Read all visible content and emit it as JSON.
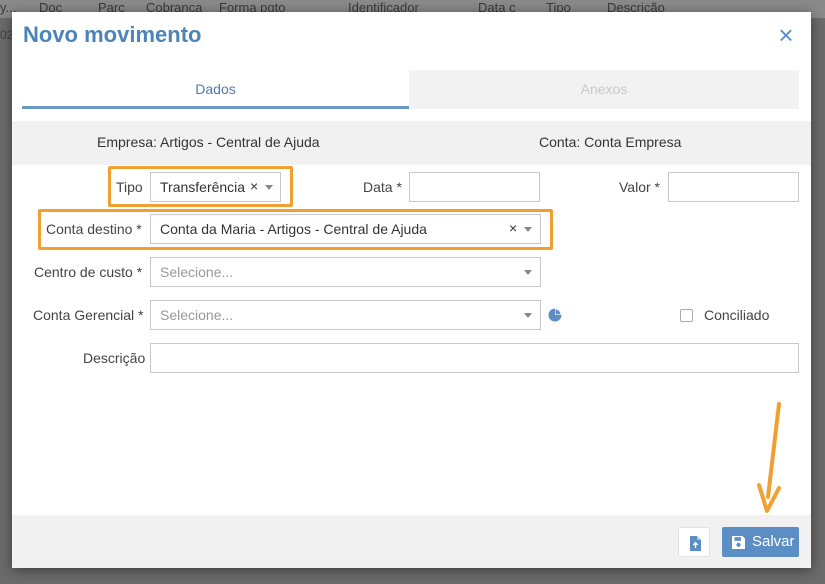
{
  "background": {
    "columns": [
      "y...",
      "Doc",
      "Parc",
      "Cobrança",
      "Forma pgto",
      "Identificador",
      "Data c",
      "Tipo",
      "Descrição"
    ],
    "left_fragment": "02"
  },
  "modal": {
    "title": "Novo movimento",
    "close_glyph": "×",
    "tabs": [
      {
        "label": "Dados",
        "active": true
      },
      {
        "label": "Anexos",
        "active": false
      }
    ],
    "info": {
      "empresa": "Empresa: Artigos - Central de Ajuda",
      "conta": "Conta: Conta Empresa"
    },
    "form": {
      "tipo": {
        "label": "Tipo",
        "value": "Transferência",
        "clear": "×"
      },
      "data": {
        "label": "Data *",
        "value": ""
      },
      "valor": {
        "label": "Valor *",
        "value": ""
      },
      "conta_destino": {
        "label": "Conta destino *",
        "value": "Conta da Maria - Artigos - Central de Ajuda",
        "clear": "×"
      },
      "centro_custo": {
        "label": "Centro de custo *",
        "placeholder": "Selecione..."
      },
      "conta_gerencial": {
        "label": "Conta Gerencial *",
        "placeholder": "Selecione..."
      },
      "conciliado": {
        "label": "Conciliado",
        "checked": false
      },
      "descricao": {
        "label": "Descrição",
        "value": ""
      }
    },
    "footer": {
      "save_label": "Salvar",
      "attach_icon": "file-upload-icon"
    }
  },
  "colors": {
    "accent": "#4d84b8",
    "highlight": "#f0a030",
    "button": "#5b8ec4"
  }
}
